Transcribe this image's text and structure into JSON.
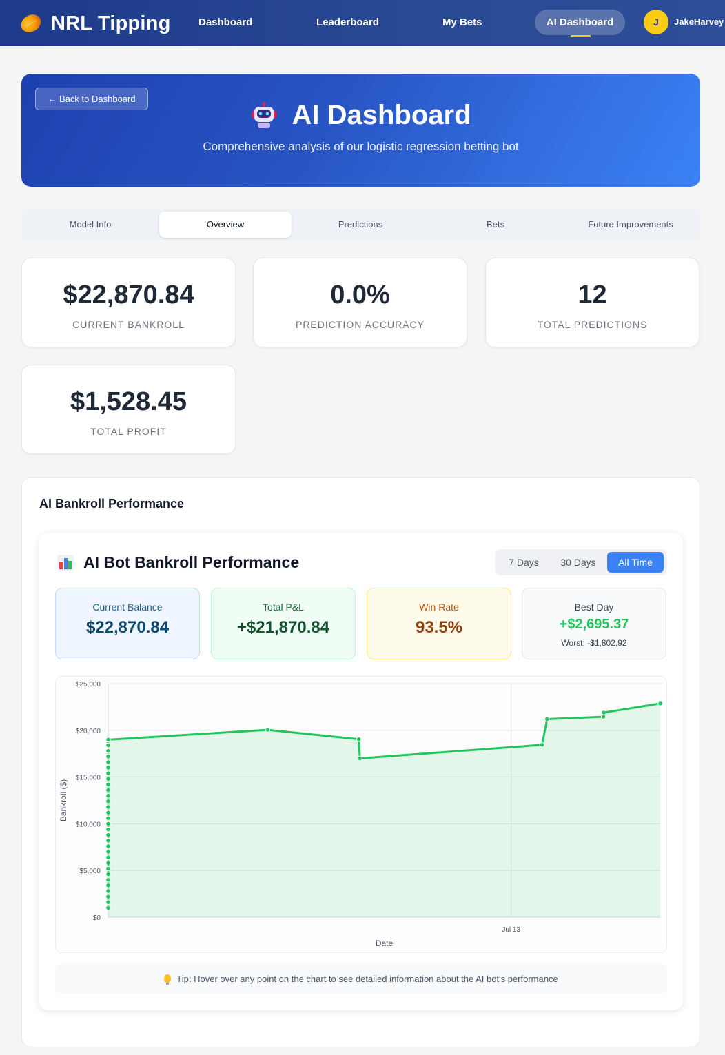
{
  "nav": {
    "brand": "NRL Tipping",
    "links": [
      "Dashboard",
      "Leaderboard",
      "My Bets"
    ],
    "active_link": "AI Dashboard",
    "avatar_initial": "J",
    "username": "JakeHarvey"
  },
  "hero": {
    "back_label": "← Back to Dashboard",
    "title": "AI Dashboard",
    "subtitle": "Comprehensive analysis of our logistic regression betting bot"
  },
  "tabs": {
    "items": [
      "Model Info",
      "Overview",
      "Predictions",
      "Bets",
      "Future Improvements"
    ],
    "active": "Overview"
  },
  "stats": [
    {
      "value": "$22,870.84",
      "label": "Current Bankroll"
    },
    {
      "value": "0.0%",
      "label": "Prediction Accuracy"
    },
    {
      "value": "12",
      "label": "Total Predictions"
    },
    {
      "value": "$1,528.45",
      "label": "Total Profit"
    }
  ],
  "performance": {
    "section_title": "AI Bankroll Performance",
    "card_title": "AI Bot Bankroll Performance",
    "ranges": [
      "7 Days",
      "30 Days",
      "All Time"
    ],
    "active_range": "All Time",
    "summary": {
      "current_balance_label": "Current Balance",
      "current_balance": "$22,870.84",
      "total_pnl_label": "Total P&L",
      "total_pnl": "+$21,870.84",
      "win_rate_label": "Win Rate",
      "win_rate": "93.5%",
      "best_day_label": "Best Day",
      "best_day": "+$2,695.37",
      "worst_day": "Worst: -$1,802.92"
    },
    "tip": "Tip: Hover over any point on the chart to see detailed information about the AI bot's performance"
  },
  "colors": {
    "line": "#22c55e",
    "fill": "#dcfce7",
    "accent": "#3b82f6",
    "nav": "#1e3a8a"
  },
  "chart_data": {
    "type": "area",
    "xlabel": "Date",
    "ylabel": "Bankroll ($)",
    "ylim": [
      0,
      25000
    ],
    "y_ticks": [
      "$0",
      "$5,000",
      "$10,000",
      "$15,000",
      "$20,000",
      "$25,000"
    ],
    "y_tick_values": [
      0,
      5000,
      10000,
      15000,
      20000,
      25000
    ],
    "x_tick": {
      "label": "Jul 13",
      "value": 0.73
    },
    "grid": true,
    "series": [
      {
        "values": [
          [
            0,
            1000
          ],
          [
            0,
            1600
          ],
          [
            0,
            2200
          ],
          [
            0,
            2800
          ],
          [
            0,
            3400
          ],
          [
            0,
            4000
          ],
          [
            0,
            4600
          ],
          [
            0,
            5200
          ],
          [
            0,
            5800
          ],
          [
            0,
            6400
          ],
          [
            0,
            7000
          ],
          [
            0,
            7600
          ],
          [
            0,
            8200
          ],
          [
            0,
            8800
          ],
          [
            0,
            9400
          ],
          [
            0,
            10000
          ],
          [
            0,
            10600
          ],
          [
            0,
            11200
          ],
          [
            0,
            11800
          ],
          [
            0,
            12400
          ],
          [
            0,
            13000
          ],
          [
            0,
            13600
          ],
          [
            0,
            14200
          ],
          [
            0,
            14800
          ],
          [
            0,
            15400
          ],
          [
            0,
            16000
          ],
          [
            0,
            16600
          ],
          [
            0,
            17200
          ],
          [
            0,
            17800
          ],
          [
            0,
            18400
          ],
          [
            0,
            19000
          ],
          [
            0.289,
            20050
          ],
          [
            0.454,
            19050
          ],
          [
            0.456,
            17000
          ],
          [
            0.786,
            18450
          ],
          [
            0.795,
            21200
          ],
          [
            0.897,
            21450
          ],
          [
            0.898,
            21900
          ],
          [
            1.0,
            22870.84
          ]
        ]
      }
    ]
  }
}
